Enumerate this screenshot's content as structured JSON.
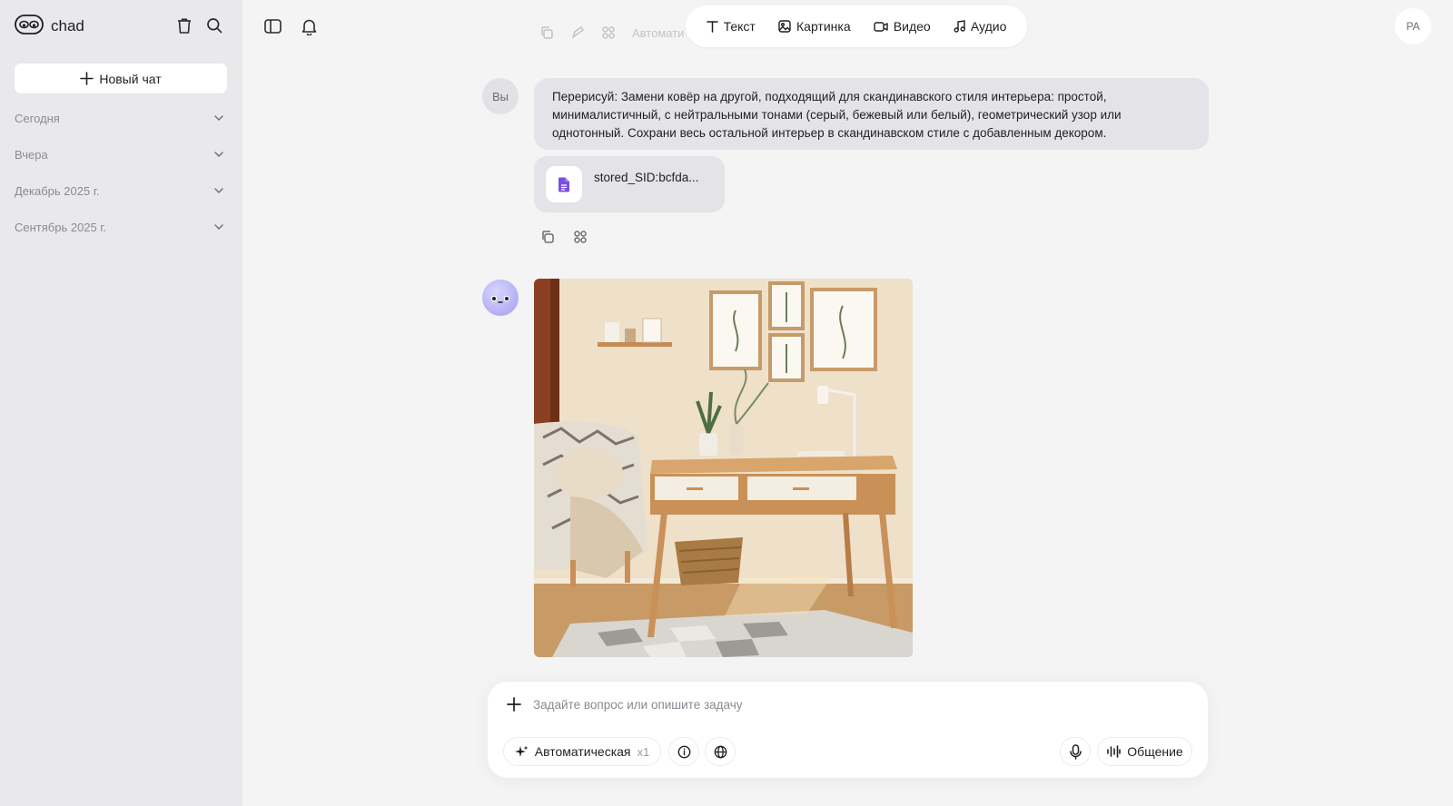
{
  "sidebar": {
    "app_name": "chad",
    "new_chat_label": "Новый чат",
    "sections": [
      "Сегодня",
      "Вчера",
      "Декабрь 2025 г.",
      "Сентябрь 2025 г."
    ]
  },
  "modes": [
    "Текст",
    "Картинка",
    "Видео",
    "Аудио"
  ],
  "user": {
    "initials": "PA"
  },
  "header_residue": {
    "text": "Автомати"
  },
  "conversation": {
    "user_avatar_label": "Вы",
    "user_message": "Перерисуй: Замени ковёр на другой, подходящий для скандинавского стиля интерьера: простой, минималистичный, с нейтральными тонами (серый, бежевый или белый), геометрический узор или однотонный. Сохрани весь остальной интерьер в скандинавском стиле с добавленным декором.",
    "attachment_name": "stored_SID:bcfda..."
  },
  "composer": {
    "placeholder": "Задайте вопрос или опишите задачу",
    "model_label": "Автоматическая",
    "multiplier": "x1",
    "voice_label": "Общение"
  },
  "colors": {
    "sidebar_bg": "#e9e9ec",
    "main_bg": "#f4f4f5",
    "bubble_bg": "#e4e4e8",
    "accent_purple": "#7b4fe0"
  }
}
